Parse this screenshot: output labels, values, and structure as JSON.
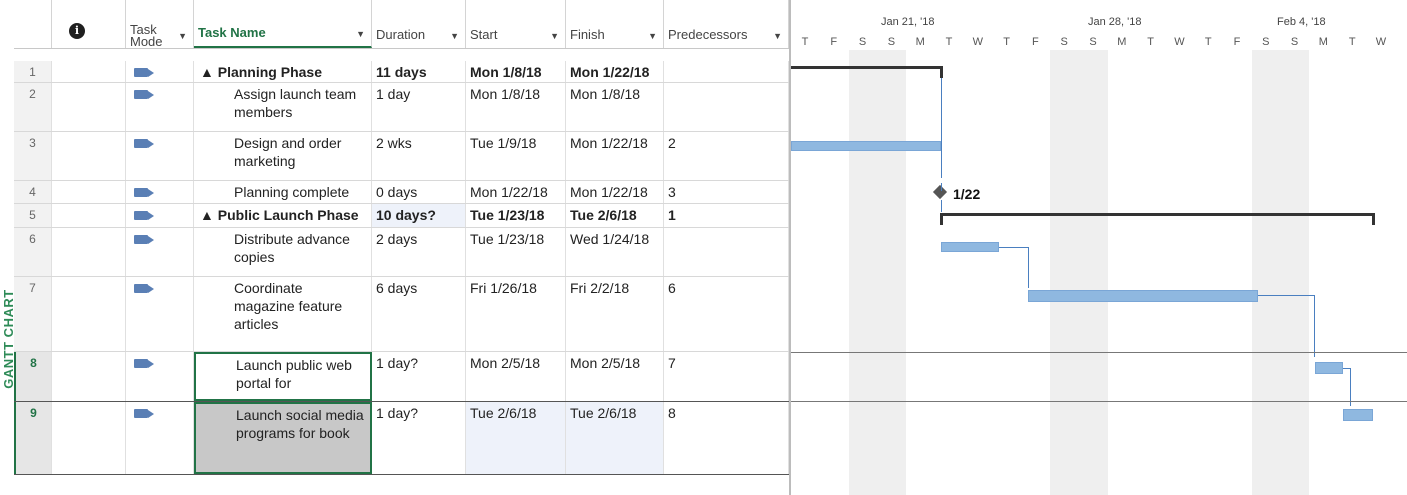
{
  "view_label": "GANTT CHART",
  "headers": {
    "info": "i",
    "mode_line1": "Task",
    "mode_line2": "Mode",
    "task_name": "Task Name",
    "duration": "Duration",
    "start": "Start",
    "finish": "Finish",
    "predecessors": "Predecessors"
  },
  "rows": [
    {
      "id": "1",
      "name": "▲ Planning Phase",
      "duration": "11 days",
      "start": "Mon 1/8/18",
      "finish": "Mon 1/22/18",
      "pred": "",
      "bold": true
    },
    {
      "id": "2",
      "name": "Assign launch team members",
      "duration": "1 day",
      "start": "Mon 1/8/18",
      "finish": "Mon 1/8/18",
      "pred": ""
    },
    {
      "id": "3",
      "name": "Design and order marketing",
      "duration": "2 wks",
      "start": "Tue 1/9/18",
      "finish": "Mon 1/22/18",
      "pred": "2"
    },
    {
      "id": "4",
      "name": "Planning complete",
      "duration": "0 days",
      "start": "Mon 1/22/18",
      "finish": "Mon 1/22/18",
      "pred": "3"
    },
    {
      "id": "5",
      "name": "▲ Public Launch Phase",
      "duration": "10 days?",
      "start": "Tue 1/23/18",
      "finish": "Tue 2/6/18",
      "pred": "1",
      "bold": true
    },
    {
      "id": "6",
      "name": "Distribute advance copies",
      "duration": "2 days",
      "start": "Tue 1/23/18",
      "finish": "Wed 1/24/18",
      "pred": ""
    },
    {
      "id": "7",
      "name": "Coordinate magazine feature articles",
      "duration": "6 days",
      "start": "Fri 1/26/18",
      "finish": "Fri 2/2/18",
      "pred": "6"
    },
    {
      "id": "8",
      "name": "Launch public web portal for",
      "duration": "1 day?",
      "start": "Mon 2/5/18",
      "finish": "Mon 2/5/18",
      "pred": "7"
    },
    {
      "id": "9",
      "name": "Launch social media programs for book",
      "duration": "1 day?",
      "start": "Tue 2/6/18",
      "finish": "Tue 2/6/18",
      "pred": "8"
    }
  ],
  "timescale": {
    "weeks": [
      "Jan 21, '18",
      "Jan 28, '18",
      "Feb 4, '18"
    ],
    "days": [
      "T",
      "F",
      "S",
      "S",
      "M",
      "T",
      "W",
      "T",
      "F",
      "S",
      "S",
      "M",
      "T",
      "W",
      "T",
      "F",
      "S",
      "S",
      "M",
      "T",
      "W"
    ]
  },
  "milestone_label": "1/22",
  "colors": {
    "accent": "#217346",
    "bar": "#8fb8e0",
    "link": "#4a7fc0"
  }
}
